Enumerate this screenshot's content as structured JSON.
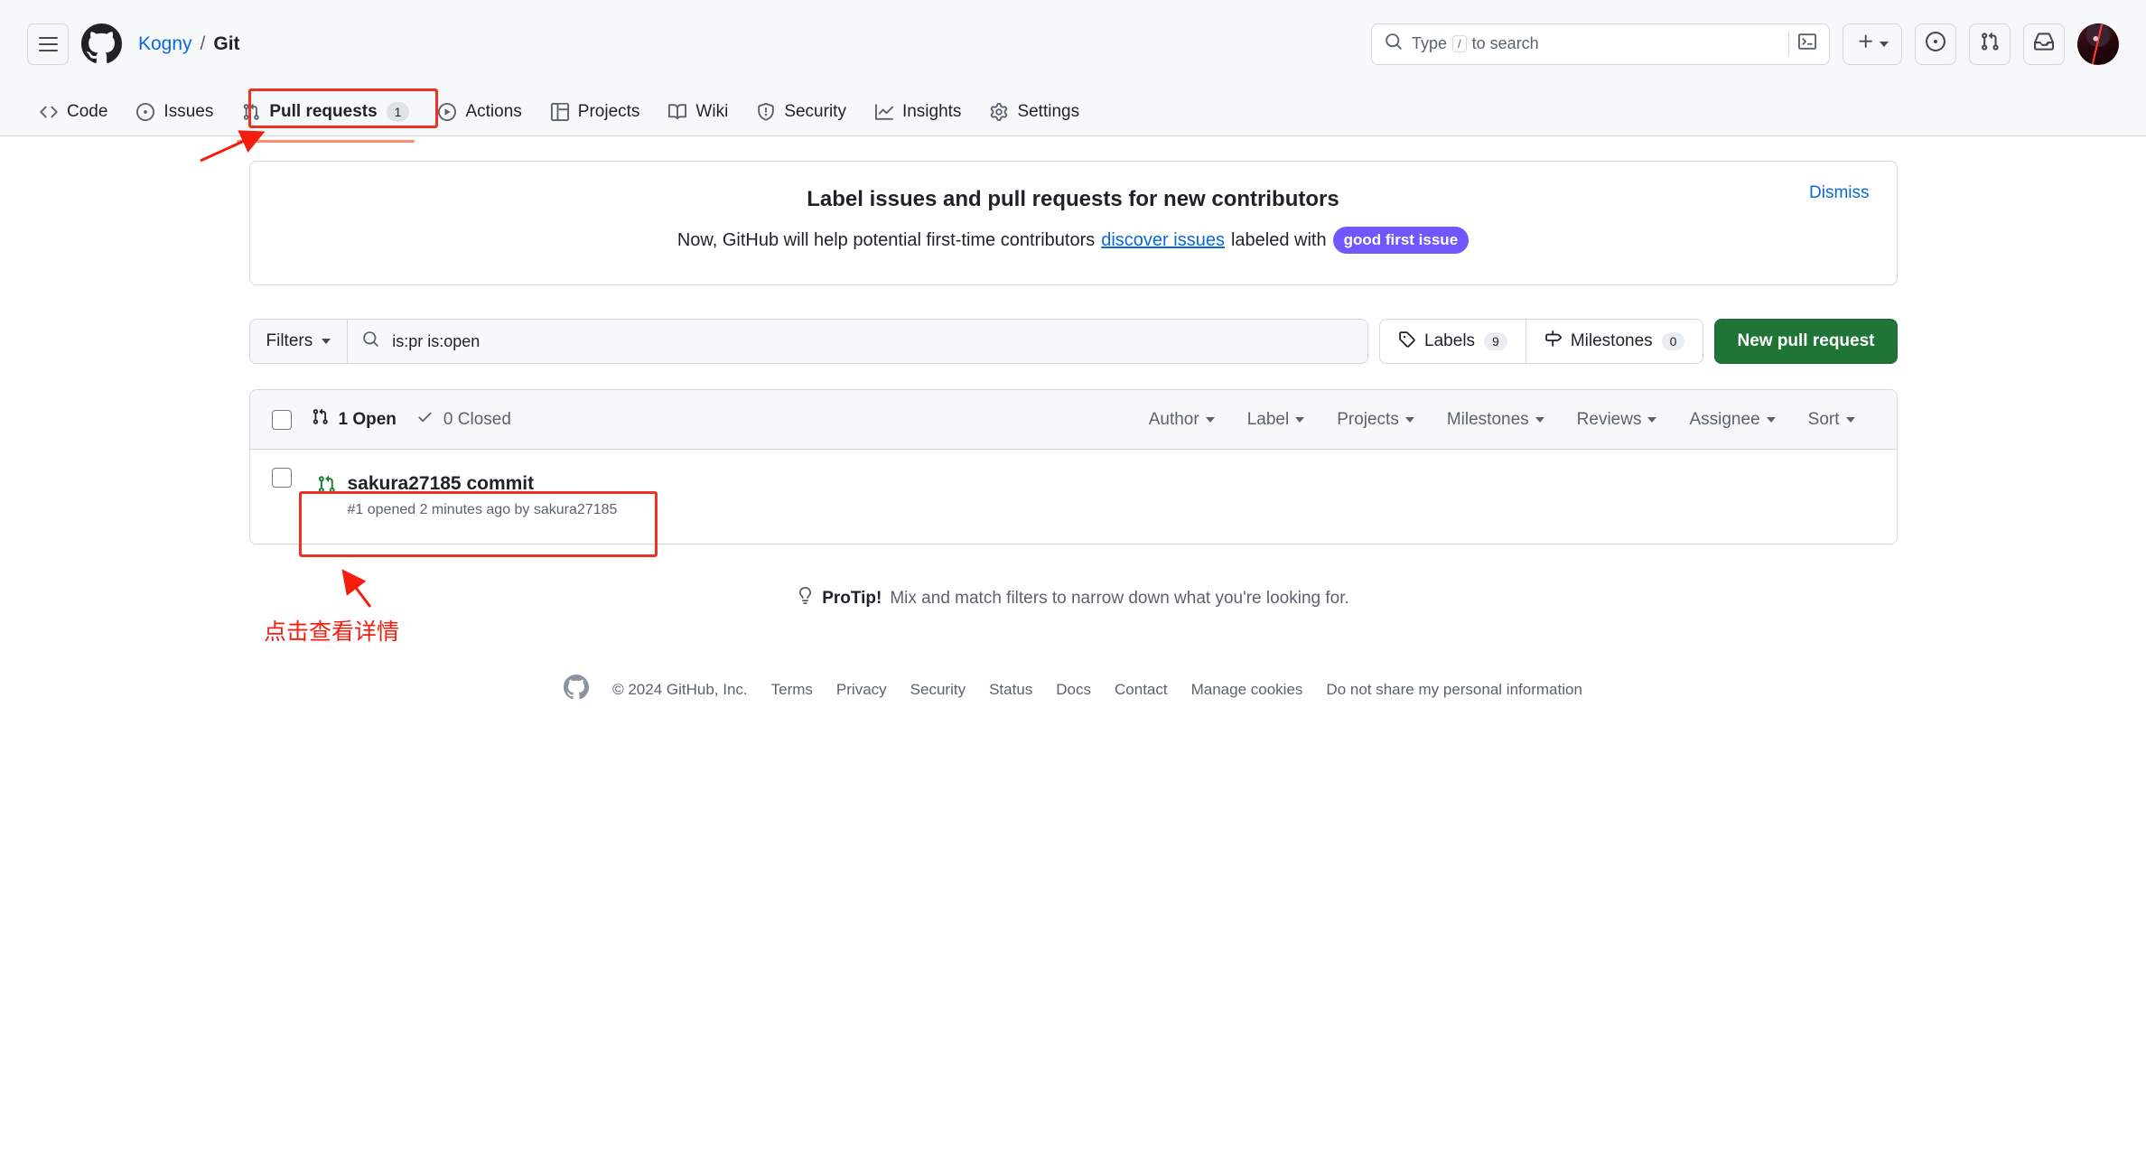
{
  "header": {
    "menu_icon": "hamburger-icon",
    "logo_icon": "github-logo",
    "breadcrumb": {
      "owner": "Kogny",
      "separator": "/",
      "repo": "Git"
    },
    "search": {
      "placeholder_prefix": "Type",
      "key_hint": "/",
      "placeholder_suffix": "to search",
      "icon": "search-icon",
      "command_icon": "terminal-icon"
    },
    "actions": [
      {
        "name": "create-new-menu",
        "icon": "plus-icon",
        "has_caret": true
      },
      {
        "name": "issues-button",
        "icon": "issue-opened-icon"
      },
      {
        "name": "pull-requests-button",
        "icon": "git-pull-request-icon"
      },
      {
        "name": "notifications-button",
        "icon": "inbox-icon"
      }
    ],
    "avatar_label": "avatar"
  },
  "repo_nav": [
    {
      "label": "Code",
      "icon": "code-icon",
      "active": false,
      "count": null
    },
    {
      "label": "Issues",
      "icon": "issue-opened-icon",
      "active": false,
      "count": null
    },
    {
      "label": "Pull requests",
      "icon": "git-pull-request-icon",
      "active": true,
      "count": "1"
    },
    {
      "label": "Actions",
      "icon": "play-icon",
      "active": false,
      "count": null
    },
    {
      "label": "Projects",
      "icon": "table-icon",
      "active": false,
      "count": null
    },
    {
      "label": "Wiki",
      "icon": "book-icon",
      "active": false,
      "count": null
    },
    {
      "label": "Security",
      "icon": "shield-icon",
      "active": false,
      "count": null
    },
    {
      "label": "Insights",
      "icon": "graph-icon",
      "active": false,
      "count": null
    },
    {
      "label": "Settings",
      "icon": "gear-icon",
      "active": false,
      "count": null
    }
  ],
  "banner": {
    "title": "Label issues and pull requests for new contributors",
    "text_before": "Now, GitHub will help potential first-time contributors",
    "link_text": "discover issues",
    "text_after": "labeled with",
    "badge": "good first issue",
    "badge_color": "#7057ff",
    "dismiss": "Dismiss"
  },
  "filter_bar": {
    "filters_label": "Filters",
    "search_value": "is:pr is:open",
    "labels": {
      "label": "Labels",
      "count": "9",
      "icon": "tag-icon"
    },
    "milestones": {
      "label": "Milestones",
      "count": "0",
      "icon": "milestone-icon"
    },
    "new_pr": {
      "label": "New pull request",
      "color": "#1f7536"
    }
  },
  "pr_list": {
    "open": {
      "label": "1 Open",
      "icon": "git-pull-request-icon"
    },
    "closed": {
      "label": "0 Closed",
      "icon": "check-icon"
    },
    "dropdowns": [
      "Author",
      "Label",
      "Projects",
      "Milestones",
      "Reviews",
      "Assignee",
      "Sort"
    ],
    "rows": [
      {
        "title": "sakura27185 commit",
        "meta": "#1 opened 2 minutes ago by sakura27185",
        "icon": "git-pull-request-icon",
        "state_color": "#1a7f37"
      }
    ]
  },
  "protip": {
    "icon": "light-bulb-icon",
    "label": "ProTip!",
    "text": "Mix and match filters to narrow down what you're looking for."
  },
  "footer": {
    "logo_icon": "github-logo",
    "copyright": "© 2024 GitHub, Inc.",
    "links": [
      "Terms",
      "Privacy",
      "Security",
      "Status",
      "Docs",
      "Contact",
      "Manage cookies",
      "Do not share my personal information"
    ]
  },
  "annotations": {
    "color": "#f41d0e",
    "note_text": "点击查看详情"
  }
}
